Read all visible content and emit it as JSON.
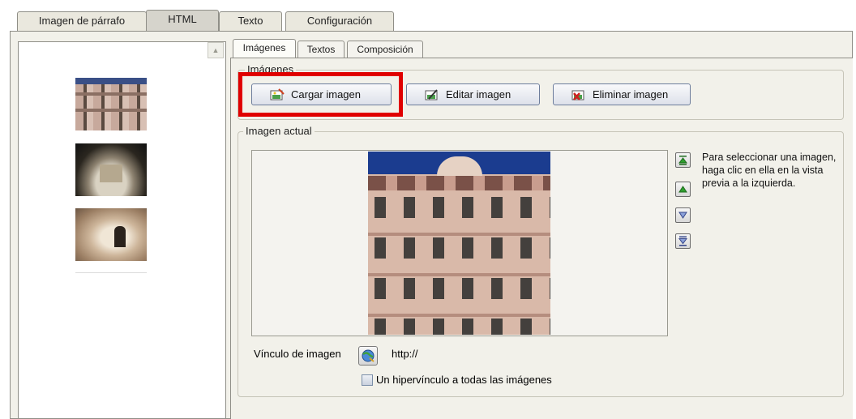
{
  "top_tabs": [
    {
      "label": "Imagen de párrafo"
    },
    {
      "label": "HTML"
    },
    {
      "label": "Texto"
    },
    {
      "label": "Configuración"
    }
  ],
  "sub_tabs": [
    {
      "label": "Imágenes"
    },
    {
      "label": "Textos"
    },
    {
      "label": "Composición"
    }
  ],
  "images_group": {
    "legend": "Imágenes",
    "buttons": {
      "load": "Cargar imagen",
      "edit": "Editar imagen",
      "delete": "Eliminar imagen"
    }
  },
  "current_image_group": {
    "legend": "Imagen actual",
    "hint": "Para seleccionar una imagen, haga clic en ella en la vista previa a la izquierda.",
    "link_label": "Vínculo de imagen",
    "link_value": "http://",
    "checkbox_label": "Un hipervínculo a todas las imágenes"
  },
  "thumbnails": [
    {
      "name": "building-facade-thumbnail"
    },
    {
      "name": "archway-courtyard-thumbnail"
    },
    {
      "name": "interior-corridor-thumbnail"
    }
  ],
  "colors": {
    "highlight": "#e00000",
    "sky": "#1a3c8c",
    "facade": "#d9b9a9"
  },
  "icons": {
    "load": "load-image-icon",
    "edit": "edit-image-icon",
    "delete": "delete-image-icon",
    "link": "globe-link-icon",
    "move_top": "move-top-icon",
    "move_up": "move-up-icon",
    "move_down": "move-down-icon",
    "move_bottom": "move-bottom-icon"
  }
}
